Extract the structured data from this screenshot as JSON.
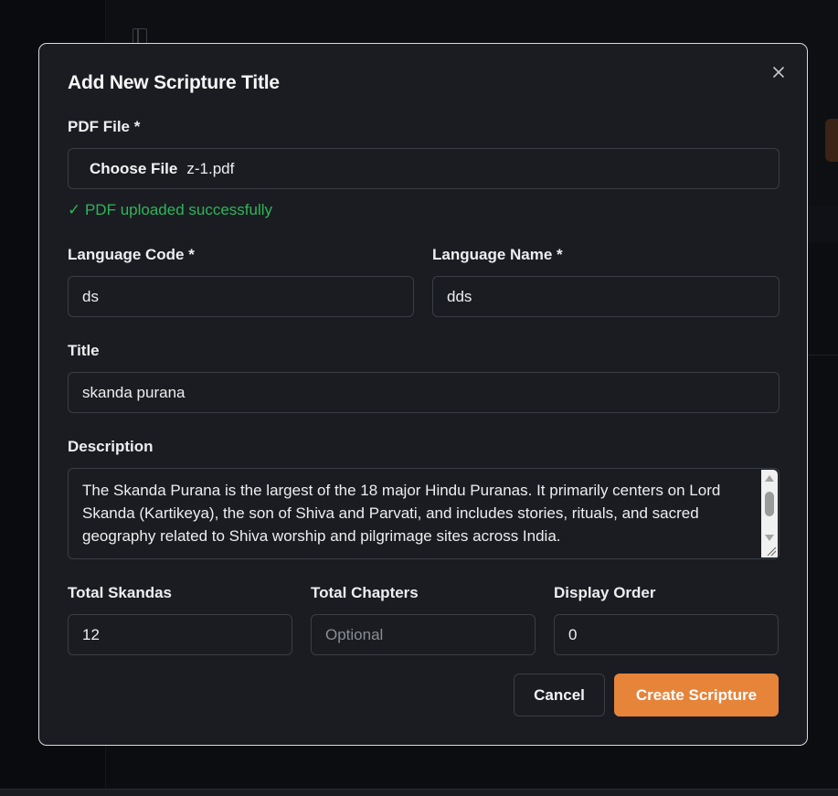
{
  "modal": {
    "title": "Add New Scripture Title",
    "close_icon": "close-icon"
  },
  "form": {
    "pdf_label": "PDF File *",
    "pdf_button": "Choose File",
    "pdf_filename": "z-1.pdf",
    "pdf_status": "✓ PDF uploaded successfully",
    "language_code_label": "Language Code *",
    "language_code_value": "ds",
    "language_name_label": "Language Name *",
    "language_name_value": "dds",
    "title_label": "Title",
    "title_value": "skanda purana",
    "description_label": "Description",
    "description_value": "The Skanda Purana is the largest of the 18 major Hindu Puranas. It primarily centers on Lord Skanda (Kartikeya), the son of Shiva and Parvati, and includes stories, rituals, and sacred geography related to Shiva worship and pilgrimage sites across India.",
    "total_skandas_label": "Total Skandas",
    "total_skandas_value": "12",
    "total_chapters_label": "Total Chapters",
    "total_chapters_placeholder": "Optional",
    "display_order_label": "Display Order",
    "display_order_value": "0"
  },
  "actions": {
    "cancel_label": "Cancel",
    "create_label": "Create Scripture"
  },
  "colors": {
    "accent": "#e6843a",
    "success": "#2fb45a",
    "modal_bg": "#1a1c21",
    "page_bg": "#0c0d10"
  }
}
